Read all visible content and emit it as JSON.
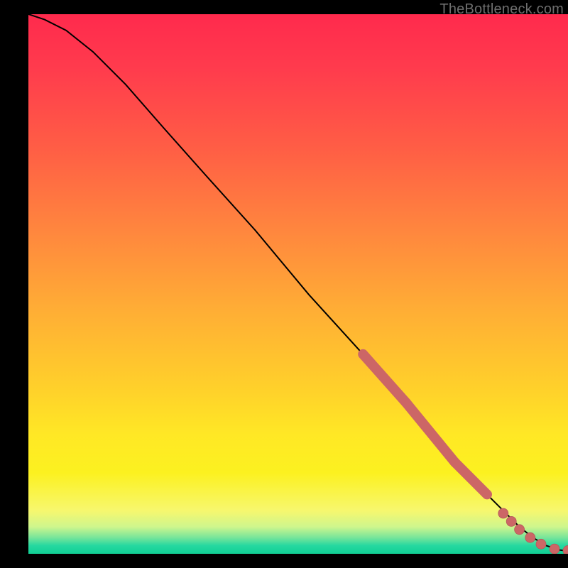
{
  "watermark": "TheBottleneck.com",
  "colors": {
    "curve": "#000000",
    "dot_fill": "#cc6666",
    "dot_stroke": "#b55a5a",
    "bg_black": "#000000"
  },
  "chart_data": {
    "type": "line",
    "title": "",
    "xlabel": "",
    "ylabel": "",
    "xlim": [
      0,
      100
    ],
    "ylim": [
      0,
      100
    ],
    "grid": false,
    "notes": "Axis ticks and labels are not visible in the image; all numeric values are estimated from pixel positions on a 0–100 scale for each axis. Background is a vertical red→yellow→green gradient. Curve starts near top-left, descends roughly linearly to bottom-right where it flattens near y≈0. Salmon-colored markers highlight the lower-right portion of the curve.",
    "series": [
      {
        "name": "curve",
        "x": [
          0,
          3,
          7,
          12,
          18,
          25,
          33,
          42,
          52,
          62,
          70,
          76,
          81,
          85,
          88,
          91,
          93.5,
          96,
          98.5,
          100
        ],
        "y": [
          100,
          99,
          97,
          93,
          87,
          79,
          70,
          60,
          48,
          37,
          28,
          21,
          15,
          11,
          8,
          5,
          3,
          1.5,
          0.7,
          0.5
        ]
      }
    ],
    "highlight_segments": [
      {
        "x0": 62,
        "y0": 37,
        "x1": 70,
        "y1": 28
      },
      {
        "x0": 70,
        "y0": 28,
        "x1": 79,
        "y1": 17
      },
      {
        "x0": 79,
        "y0": 17,
        "x1": 85,
        "y1": 11
      }
    ],
    "dots": [
      {
        "x": 88,
        "y": 7.5
      },
      {
        "x": 89.5,
        "y": 6
      },
      {
        "x": 91,
        "y": 4.5
      },
      {
        "x": 93,
        "y": 3
      },
      {
        "x": 95,
        "y": 1.8
      },
      {
        "x": 97.5,
        "y": 0.9
      },
      {
        "x": 100,
        "y": 0.6
      }
    ]
  }
}
